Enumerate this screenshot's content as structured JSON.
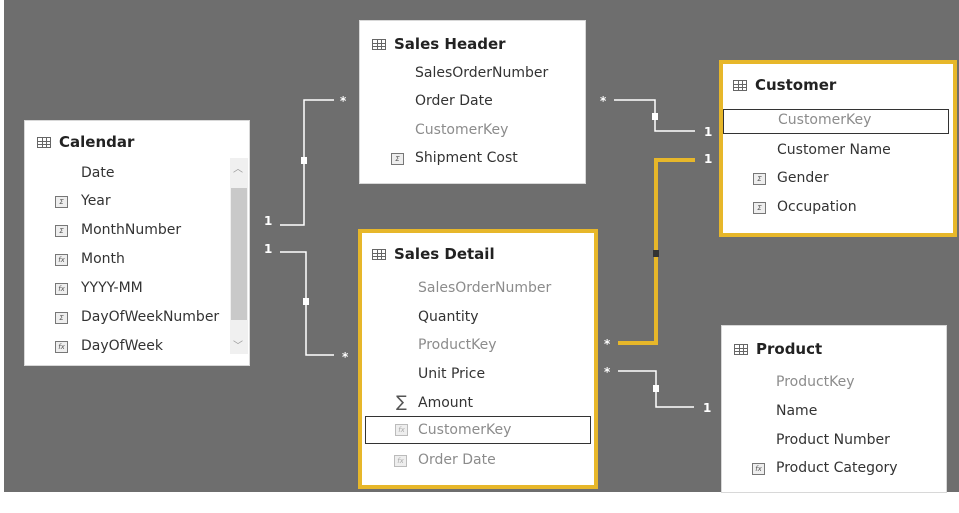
{
  "tables": {
    "calendar": {
      "title": "Calendar",
      "fields": [
        "Date",
        "Year",
        "MonthNumber",
        "Month",
        "YYYY-MM",
        "DayOfWeekNumber",
        "DayOfWeek"
      ]
    },
    "sales_header": {
      "title": "Sales Header",
      "fields": [
        "SalesOrderNumber",
        "Order Date",
        "CustomerKey",
        "Shipment Cost"
      ]
    },
    "customer": {
      "title": "Customer",
      "fields": [
        "CustomerKey",
        "Customer Name",
        "Gender",
        "Occupation"
      ]
    },
    "sales_detail": {
      "title": "Sales Detail",
      "fields": [
        "SalesOrderNumber",
        "Quantity",
        "ProductKey",
        "Unit Price",
        "Amount",
        "CustomerKey",
        "Order Date"
      ]
    },
    "product": {
      "title": "Product",
      "fields": [
        "ProductKey",
        "Name",
        "Product Number",
        "Product Category"
      ]
    }
  },
  "cardinality": {
    "one": "1",
    "many": "*"
  },
  "colors": {
    "canvas": "#6e6e6e",
    "highlight": "#e7b72a",
    "line": "#ffffff"
  }
}
